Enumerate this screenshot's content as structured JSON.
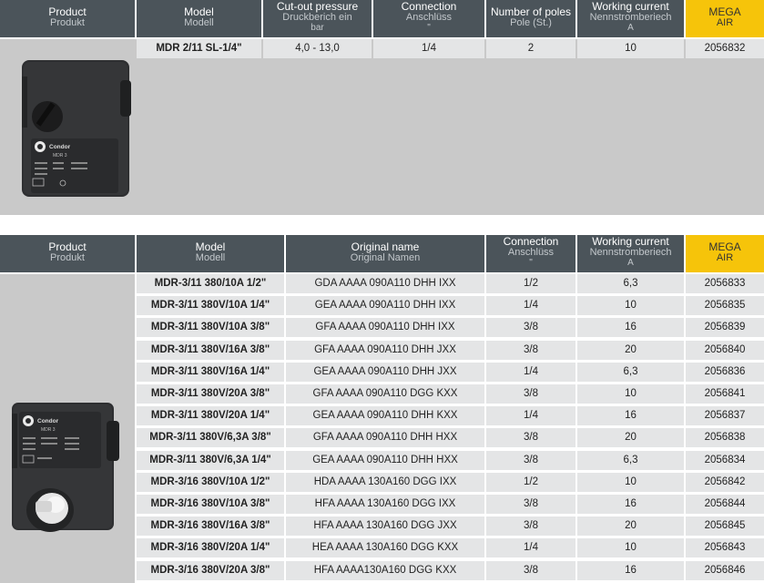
{
  "table1": {
    "headers": {
      "product": [
        "Product",
        "Produkt"
      ],
      "model": [
        "Model",
        "Modell"
      ],
      "cutout": [
        "Cut-out pressure",
        "Druckberich ein",
        "bar"
      ],
      "connection": [
        "Connection",
        "Anschlüss",
        "\""
      ],
      "poles": [
        "Number of poles",
        "Pole (St.)"
      ],
      "current": [
        "Working current",
        "Nennstromberiech",
        "A"
      ],
      "mega": [
        "MEGA",
        "AIR"
      ]
    },
    "rows": [
      {
        "model": "MDR 2/11  SL-1/4\"",
        "cutout": "4,0 - 13,0",
        "connection": "1/4",
        "poles": "2",
        "current": "10",
        "mega": "2056832"
      }
    ],
    "device_text": {
      "brand": "Condor",
      "model": "MDR 3"
    }
  },
  "table2": {
    "headers": {
      "product": [
        "Product",
        "Produkt"
      ],
      "model": [
        "Model",
        "Modell"
      ],
      "original": [
        "Original name",
        "Original Namen"
      ],
      "connection": [
        "Connection",
        "Anschlüss",
        "\""
      ],
      "current": [
        "Working current",
        "Nennstromberiech",
        "A"
      ],
      "mega": [
        "MEGA",
        "AIR"
      ]
    },
    "rows": [
      {
        "model": "MDR-3/11 380/10A 1/2\"",
        "original": "GDA AAAA 090A110 DHH IXX",
        "connection": "1/2",
        "current": "6,3",
        "mega": "2056833"
      },
      {
        "model": "MDR-3/11 380V/10A 1/4\"",
        "original": "GEA AAAA 090A110 DHH IXX",
        "connection": "1/4",
        "current": "10",
        "mega": "2056835"
      },
      {
        "model": "MDR-3/11 380V/10A 3/8\"",
        "original": "GFA AAAA 090A110 DHH IXX",
        "connection": "3/8",
        "current": "16",
        "mega": "2056839"
      },
      {
        "model": "MDR-3/11 380V/16A 3/8\"",
        "original": "GFA AAAA 090A110 DHH JXX",
        "connection": "3/8",
        "current": "20",
        "mega": "2056840"
      },
      {
        "model": "MDR-3/11 380V/16A 1/4\"",
        "original": "GEA AAAA 090A110 DHH JXX",
        "connection": "1/4",
        "current": "6,3",
        "mega": "2056836"
      },
      {
        "model": "MDR-3/11 380V/20A 3/8\"",
        "original": "GFA AAAA 090A110 DGG KXX",
        "connection": "3/8",
        "current": "10",
        "mega": "2056841"
      },
      {
        "model": "MDR-3/11 380V/20A 1/4\"",
        "original": "GEA AAAA 090A110 DHH KXX",
        "connection": "1/4",
        "current": "16",
        "mega": "2056837"
      },
      {
        "model": "MDR-3/11 380V/6,3A 3/8\"",
        "original": "GFA AAAA 090A110 DHH HXX",
        "connection": "3/8",
        "current": "20",
        "mega": "2056838"
      },
      {
        "model": "MDR-3/11 380V/6,3A 1/4\"",
        "original": "GEA AAAA 090A110 DHH HXX",
        "connection": "3/8",
        "current": "6,3",
        "mega": "2056834"
      },
      {
        "model": "MDR-3/16 380V/10A 1/2\"",
        "original": "HDA AAAA 130A160 DGG IXX",
        "connection": "1/2",
        "current": "10",
        "mega": "2056842"
      },
      {
        "model": "MDR-3/16 380V/10A 3/8\"",
        "original": "HFA AAAA 130A160 DGG IXX",
        "connection": "3/8",
        "current": "16",
        "mega": "2056844"
      },
      {
        "model": "MDR-3/16 380V/16A 3/8\"",
        "original": "HFA AAAA 130A160 DGG JXX",
        "connection": "3/8",
        "current": "20",
        "mega": "2056845"
      },
      {
        "model": "MDR-3/16 380V/20A 1/4\"",
        "original": "HEA AAAA 130A160 DGG KXX",
        "connection": "1/4",
        "current": "10",
        "mega": "2056843"
      },
      {
        "model": "MDR-3/16 380V/20A 3/8\"",
        "original": "HFA AAAA130A160 DGG KXX",
        "connection": "3/8",
        "current": "16",
        "mega": "2056846"
      }
    ],
    "device_text": {
      "brand": "Condor",
      "model": "MDR 3"
    }
  },
  "colors": {
    "header": "#4b545a",
    "mega": "#f6c40a",
    "cell": "#e4e5e6",
    "image_bg": "#c9c9c9"
  }
}
